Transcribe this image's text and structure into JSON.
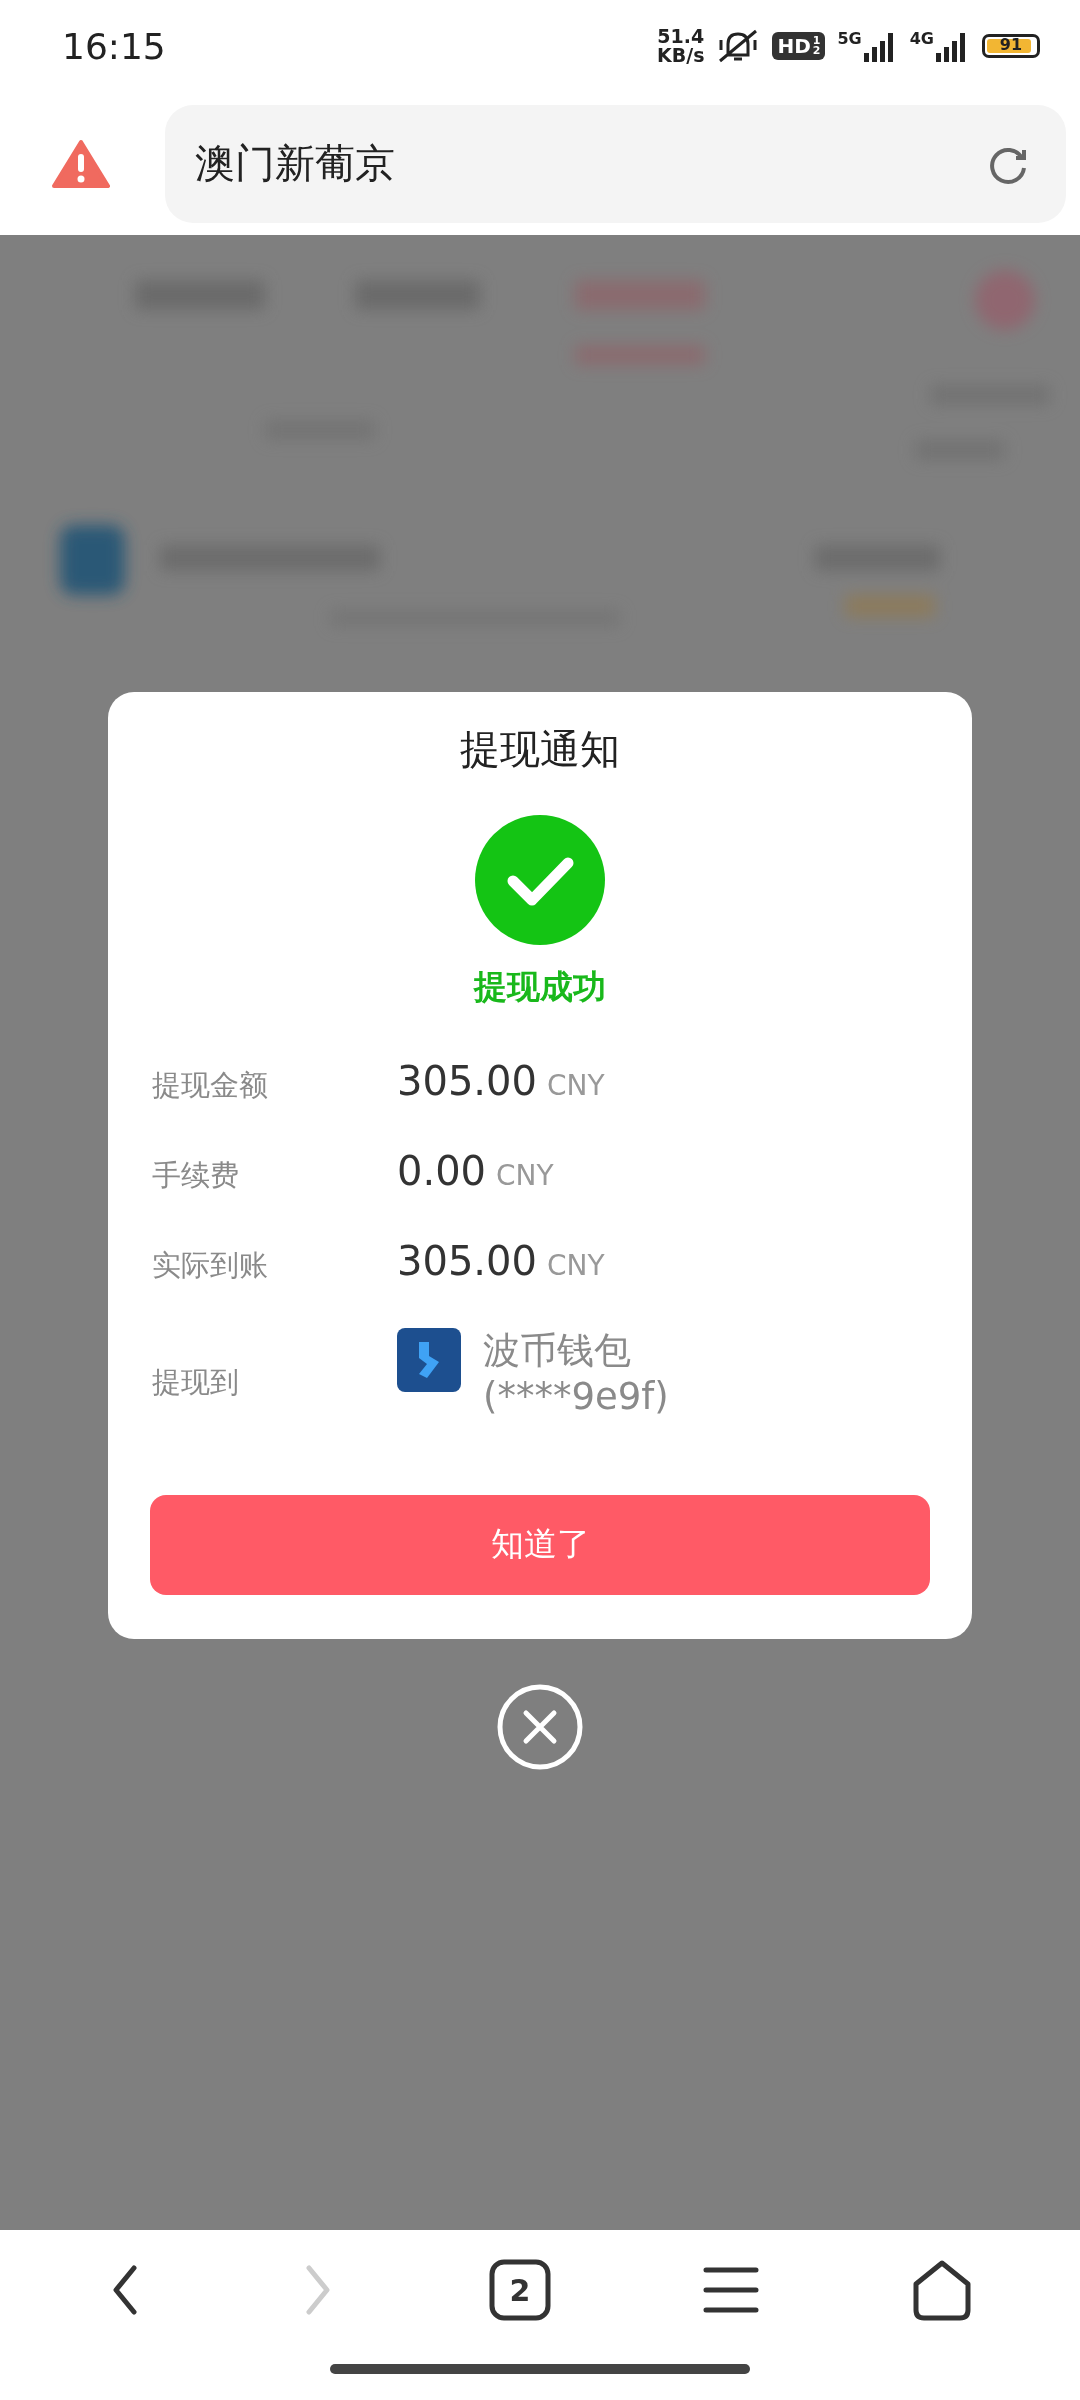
{
  "status_bar": {
    "time": "16:15",
    "net_speed": "51.4",
    "net_unit": "KB/s",
    "hd": "HD",
    "hd_sims": [
      "1",
      "2"
    ],
    "networks": [
      "5G",
      "4G"
    ],
    "battery": "91"
  },
  "address_bar": {
    "warning": true,
    "value": "澳门新葡京"
  },
  "dialog": {
    "title": "提现通知",
    "status": "提现成功",
    "success": true,
    "rows": [
      {
        "label": "提现金额",
        "amount": "305.00",
        "unit": "CNY"
      },
      {
        "label": "手续费",
        "amount": "0.00",
        "unit": "CNY"
      },
      {
        "label": "实际到账",
        "amount": "305.00",
        "unit": "CNY"
      }
    ],
    "destination": {
      "label": "提现到",
      "name": "波币钱包",
      "account": "(****9e9f)"
    },
    "button": "知道了"
  },
  "nav": [
    {
      "kind": "back",
      "disabled": false
    },
    {
      "kind": "forward",
      "disabled": true
    },
    {
      "kind": "tabs",
      "count": "2",
      "disabled": false
    },
    {
      "kind": "menu",
      "disabled": false
    },
    {
      "kind": "home",
      "disabled": false
    }
  ]
}
